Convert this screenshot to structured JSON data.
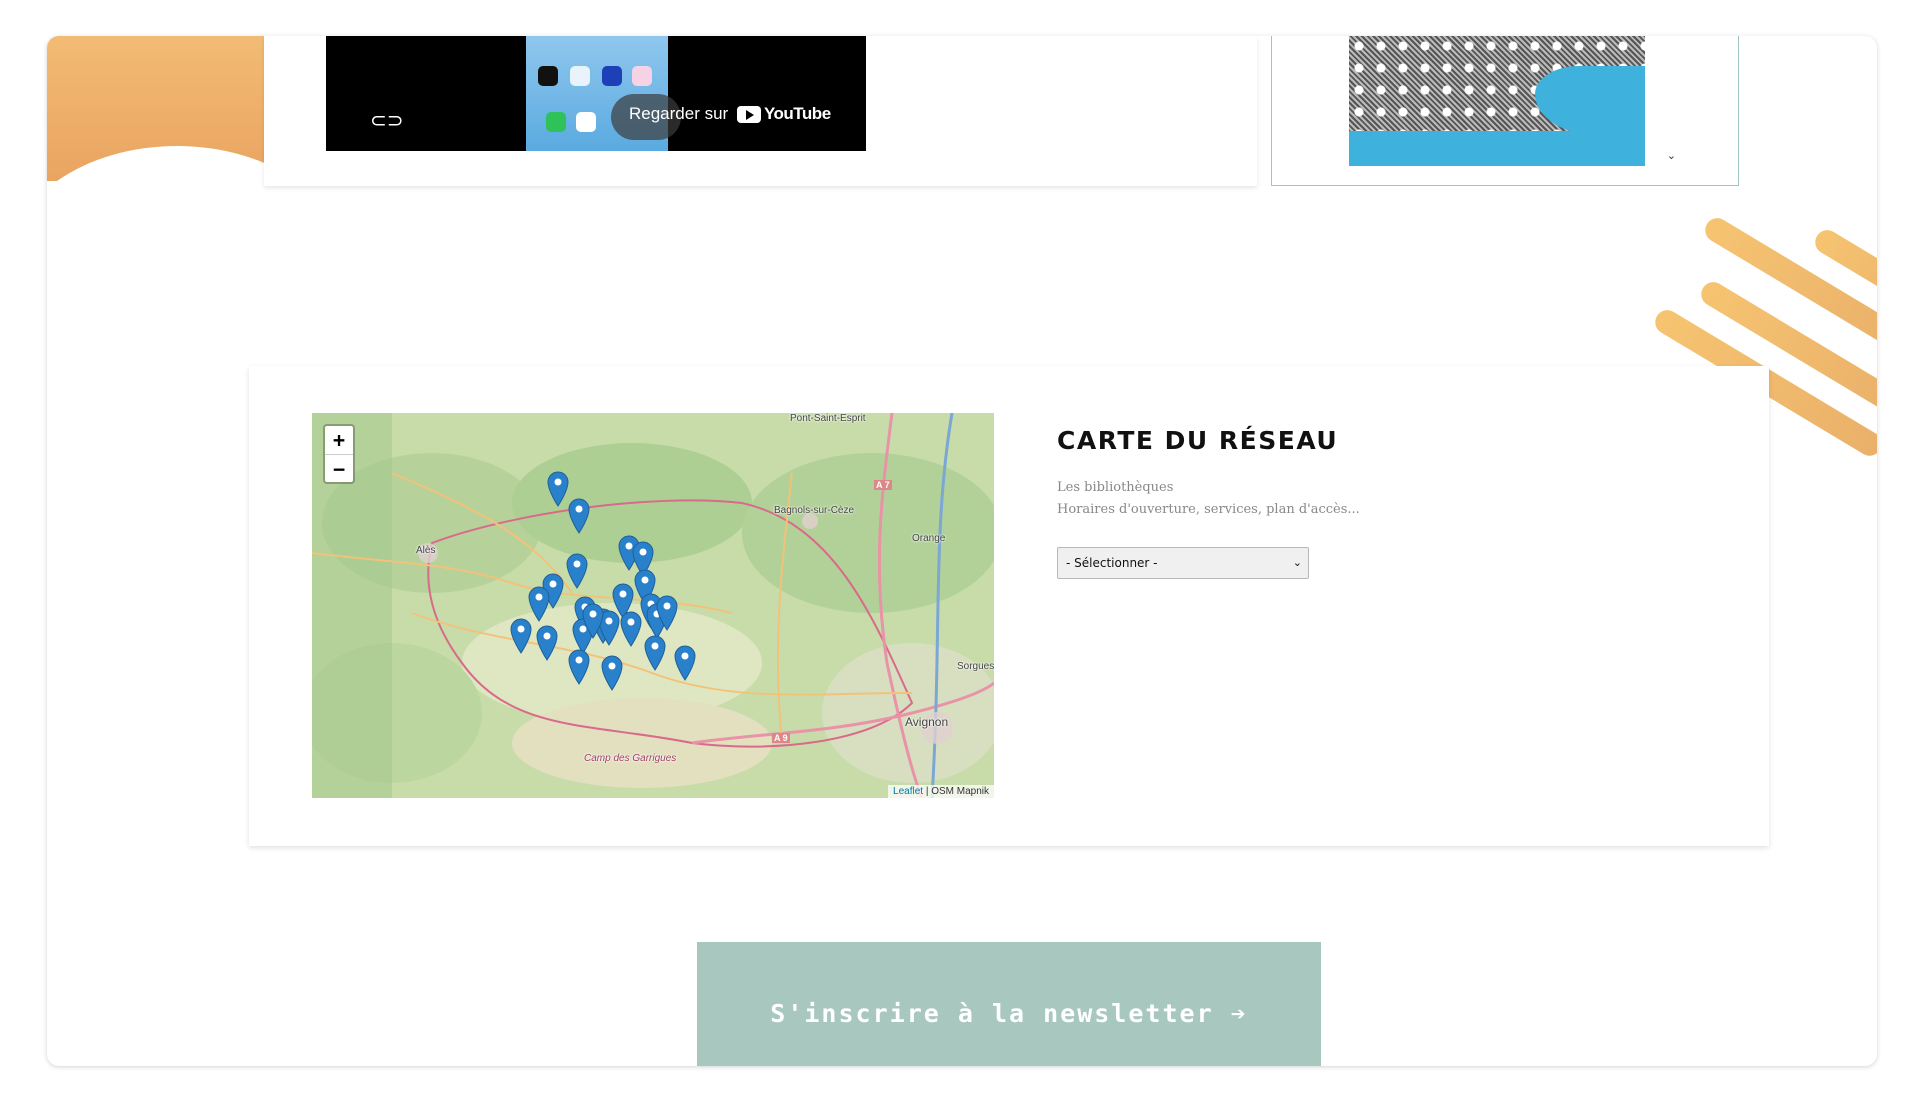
{
  "video": {
    "watch_label": "Regarder sur",
    "youtube_brand": "YouTube"
  },
  "map_section": {
    "title": "CARTE DU RÉSEAU",
    "subtitle_line1": "Les bibliothèques",
    "subtitle_line2": "Horaires d'ouverture, services, plan d'accès...",
    "select": {
      "selected": "- Sélectionner -"
    },
    "zoom_in": "+",
    "zoom_out": "−",
    "attribution_link": "Leaflet",
    "attribution_text": " | OSM Mapnik",
    "places": [
      "Pont-Saint-Esprit",
      "Bagnols-sur-Cèze",
      "Orange",
      "Alès",
      "Sorgues",
      "Avignon",
      "Camp des Garrigues"
    ],
    "roads": [
      "A 7",
      "A 9"
    ],
    "marker_count": 24,
    "marker_color": "#2a81cb"
  },
  "newsletter": {
    "label": "S'inscrire à la newsletter ➔"
  },
  "colors": {
    "accent_orange": "#f2bb74",
    "newsletter_bg": "#a8c8bf",
    "poster_blue": "#3eb2dc"
  }
}
